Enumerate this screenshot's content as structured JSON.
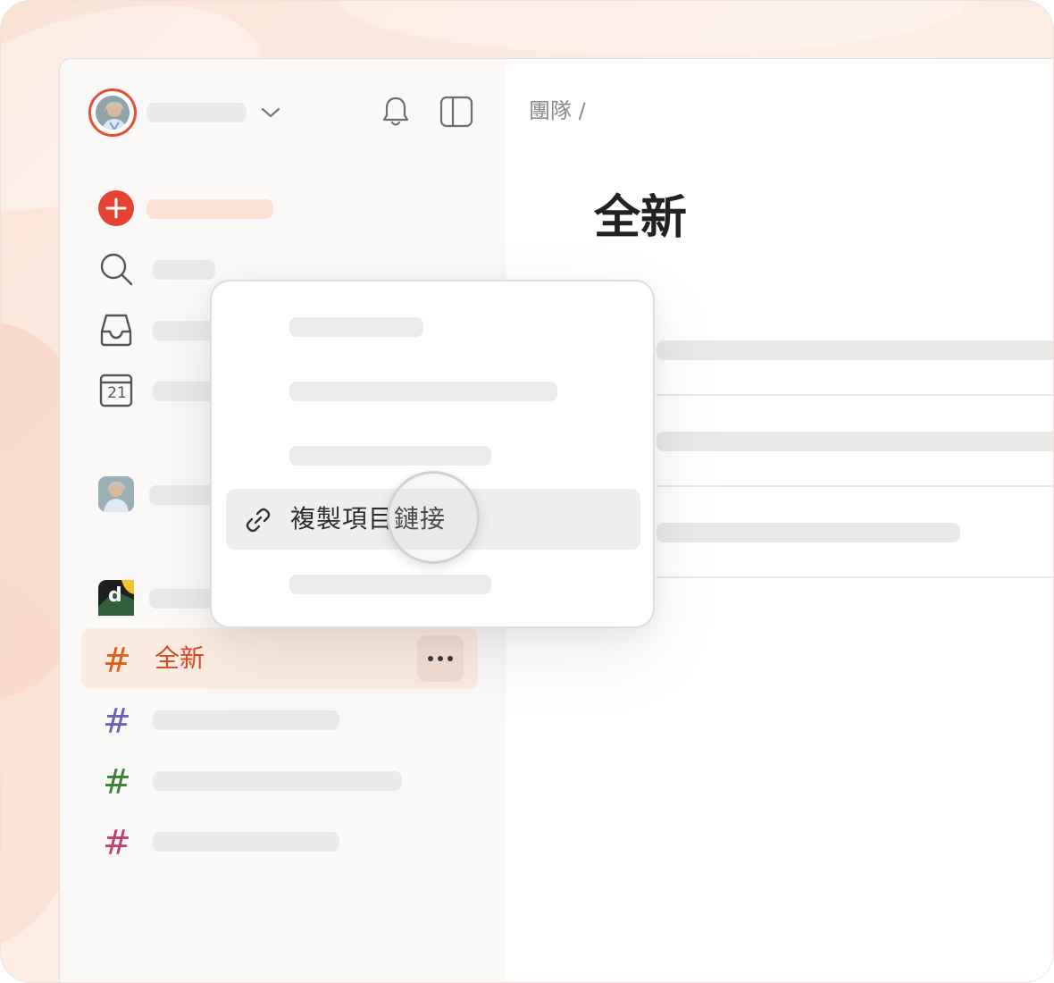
{
  "header": {
    "avatar_alt": "user avatar",
    "username": "",
    "icons": [
      "chevron-down-icon",
      "bell-icon",
      "sidebar-toggle-icon"
    ]
  },
  "sidebar": {
    "nav": [
      {
        "icon": "add-task-icon",
        "label": ""
      },
      {
        "icon": "search-icon",
        "label": ""
      },
      {
        "icon": "inbox-icon",
        "label": ""
      },
      {
        "icon": "calendar-icon",
        "label": "",
        "calendar_day": "21"
      }
    ],
    "workspace_avatar_label": "",
    "team_logo_letter": "d",
    "projects": [
      {
        "label": "全新",
        "color": "#e05d1a",
        "selected": true
      },
      {
        "label": "",
        "color": "#6b5fb8"
      },
      {
        "label": "",
        "color": "#3f7d3a"
      },
      {
        "label": "",
        "color": "#c43f6d"
      }
    ]
  },
  "main": {
    "breadcrumb": "團隊 /",
    "title": "全新"
  },
  "context_menu": {
    "active_item": {
      "icon": "link-icon",
      "label": "複製項目鏈接"
    }
  },
  "colors": {
    "accent_red": "#e44332",
    "selected_bg": "#fcebe1",
    "selected_text": "#d64a27"
  }
}
